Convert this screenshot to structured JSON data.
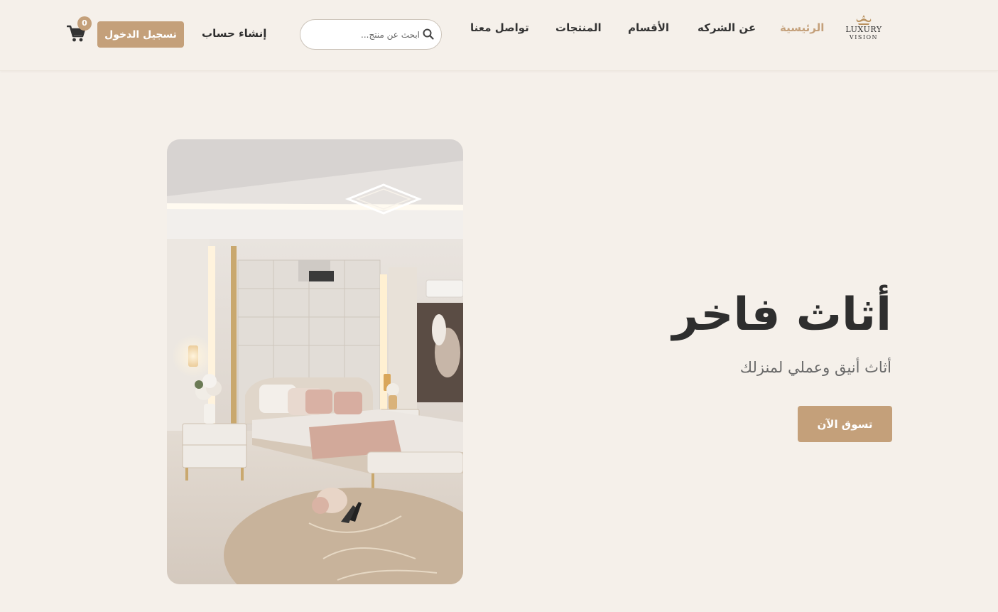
{
  "brand": {
    "logo_line1": "LUXURY",
    "logo_line2": "VISION",
    "accent_color": "#c4a07a",
    "background_color": "#f5f0ea"
  },
  "nav": {
    "items": [
      {
        "label": "الرئيسية",
        "active": true
      },
      {
        "label": "عن الشركه",
        "active": false
      },
      {
        "label": "الأقسام",
        "active": false
      },
      {
        "label": "المنتجات",
        "active": false
      },
      {
        "label": "تواصل معنا",
        "active": false
      }
    ]
  },
  "search": {
    "placeholder": "ابحث عن منتج...",
    "value": "",
    "icon": "search-icon"
  },
  "account": {
    "signup_label": "إنشاء حساب",
    "login_label": "تسجيل الدخول"
  },
  "cart": {
    "icon": "cart-icon",
    "count": "0"
  },
  "hero": {
    "title": "أثاث فاخر",
    "subtitle": "أثاث أنيق وعملي لمنزلك",
    "cta_label": "تسوق الآن",
    "image": "luxury-bedroom-photo"
  }
}
